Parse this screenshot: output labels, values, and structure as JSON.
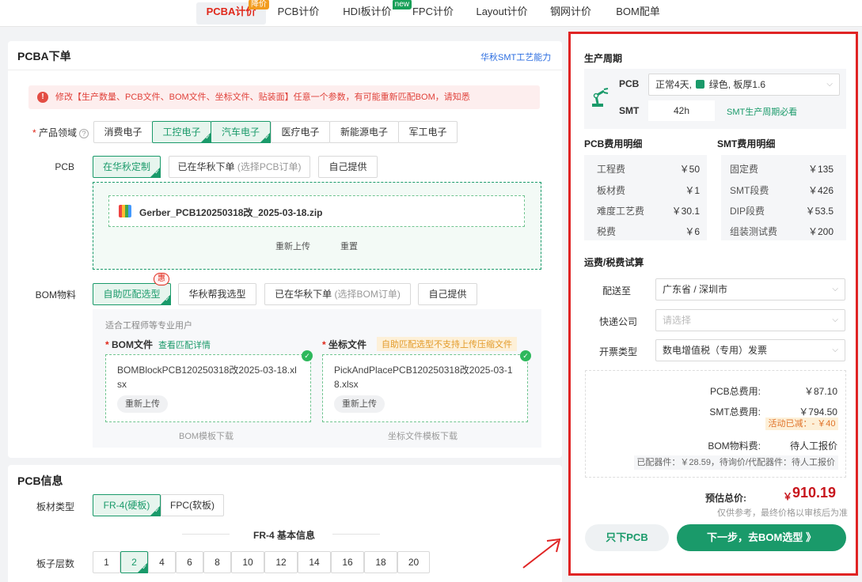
{
  "nav": {
    "tabs": [
      {
        "label": "PCBA计价"
      },
      {
        "label": "PCB计价"
      },
      {
        "label": "HDI板计价"
      },
      {
        "label": "FPC计价"
      },
      {
        "label": "Layout计价"
      },
      {
        "label": "钢网计价"
      },
      {
        "label": "BOM配单"
      }
    ],
    "badge_price_drop": "降价",
    "badge_new": "new"
  },
  "order": {
    "title": "PCBA下单",
    "smt_link": "华秋SMT工艺能力",
    "alert": "修改【生产数量、PCB文件、BOM文件、坐标文件、贴装面】任意一个参数，有可能重新匹配BOM，请知悉",
    "domain_label": "产品领域",
    "domains": [
      "消费电子",
      "工控电子",
      "汽车电子",
      "医疗电子",
      "新能源电子",
      "军工电子"
    ],
    "pcb_label": "PCB",
    "pcb_opts": [
      "在华秋定制",
      "已在华秋下单",
      "(选择PCB订单)",
      "自己提供"
    ],
    "pcb_file": "Gerber_PCB120250318改_2025-03-18.zip",
    "reupload": "重新上传",
    "reset": "重置",
    "bom_label": "BOM物料",
    "bom_opts": [
      "自助匹配选型",
      "华秋帮我选型",
      "已在华秋下单",
      "(选择BOM订单)",
      "自己提供"
    ],
    "bom_badge": "惠",
    "engineer_tip": "适合工程师等专业用户",
    "bom_file_label": "BOM文件",
    "bom_view_link": "查看匹配详情",
    "coord_file_label": "坐标文件",
    "coord_warning": "自助匹配选型不支持上传压缩文件",
    "bom_file_name": "BOMBlockPCB120250318改2025-03-18.xlsx",
    "coord_file_name": "PickAndPlacePCB120250318改2025-03-18.xlsx",
    "bom_template": "BOM模板下载",
    "coord_template": "坐标文件模板下载"
  },
  "pcb_info": {
    "title": "PCB信息",
    "material_label": "板材类型",
    "materials": [
      "FR-4(硬板)",
      "FPC(软板)"
    ],
    "fr4_title": "FR-4 基本信息",
    "layers_label": "板子层数",
    "layers": [
      "1",
      "2",
      "4",
      "6",
      "8",
      "10",
      "12",
      "14",
      "16",
      "18",
      "20"
    ]
  },
  "summary": {
    "cycle_title": "生产周期",
    "pcb_label": "PCB",
    "pcb_cycle": "正常4天,",
    "pcb_color": "绿色",
    "pcb_thick": "板厚1.6",
    "smt_label": "SMT",
    "smt_cycle": "42h",
    "smt_link": "SMT生产周期必看",
    "pcb_cost_title": "PCB费用明细",
    "smt_cost_title": "SMT费用明细",
    "pcb_costs": [
      {
        "name": "工程费",
        "value": "￥50"
      },
      {
        "name": "板材费",
        "value": "￥1"
      },
      {
        "name": "难度工艺费",
        "value": "￥30.1"
      },
      {
        "name": "税费",
        "value": "￥6"
      }
    ],
    "smt_costs": [
      {
        "name": "固定费",
        "value": "￥135"
      },
      {
        "name": "SMT段费",
        "value": "￥426"
      },
      {
        "name": "DIP段费",
        "value": "￥53.5"
      },
      {
        "name": "组装测试费",
        "value": "￥200"
      }
    ],
    "ship_title": "运费/税费试算",
    "ship_to_label": "配送至",
    "ship_to": "广东省 / 深圳市",
    "courier_label": "快递公司",
    "courier_placeholder": "请选择",
    "invoice_label": "开票类型",
    "invoice": "数电增值税（专用）发票",
    "pcb_total_label": "PCB总费用:",
    "pcb_total": "￥87.10",
    "smt_total_label": "SMT总费用:",
    "smt_total": "￥794.50",
    "discount": "活动已减：- ￥40",
    "bom_fee_label": "BOM物料费:",
    "bom_fee": "待人工报价",
    "bom_detail": "已配器件：￥28.59，待询价/代配器件：待人工报价",
    "est_label": "预估总价:",
    "est_currency": "￥",
    "est_total": "910.19",
    "est_note": "仅供参考，最终价格以审核后为准",
    "btn_pcb_only": "只下PCB",
    "btn_next": "下一步，去BOM选型 》"
  },
  "colors": {
    "accent": "#1a9a6a",
    "alert": "#e02424",
    "price": "#c8161d"
  }
}
